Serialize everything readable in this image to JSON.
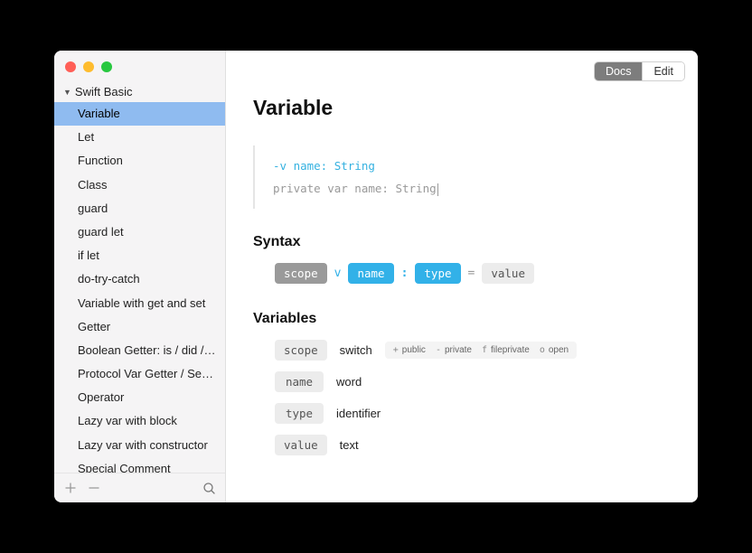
{
  "sidebar": {
    "group_title": "Swift Basic",
    "items": [
      "Variable",
      "Let",
      "Function",
      "Class",
      "guard",
      "guard let",
      "if let",
      "do-try-catch",
      "Variable with get and set",
      "Getter",
      "Boolean Getter: is / did / ha...",
      "Protocol Var Getter / Setter",
      "Operator",
      "Lazy var with block",
      "Lazy var with constructor",
      "Special Comment"
    ],
    "selected_index": 0
  },
  "toolbar": {
    "docs": "Docs",
    "edit": "Edit"
  },
  "page": {
    "title": "Variable",
    "code_line1": "-v name: String",
    "code_line2": "private var name: String",
    "syntax_h": "Syntax",
    "variables_h": "Variables",
    "syntax": {
      "scope": "scope",
      "v": "v",
      "name": "name",
      "colon": ":",
      "type": "type",
      "eq": "=",
      "value": "value"
    },
    "variables": {
      "scope": {
        "label": "scope",
        "desc": "switch",
        "options": [
          {
            "k": "+",
            "v": "public"
          },
          {
            "k": "-",
            "v": "private"
          },
          {
            "k": "f",
            "v": "fileprivate"
          },
          {
            "k": "o",
            "v": "open"
          }
        ]
      },
      "name": {
        "label": "name",
        "desc": "word"
      },
      "type": {
        "label": "type",
        "desc": "identifier"
      },
      "value": {
        "label": "value",
        "desc": "text"
      }
    }
  }
}
